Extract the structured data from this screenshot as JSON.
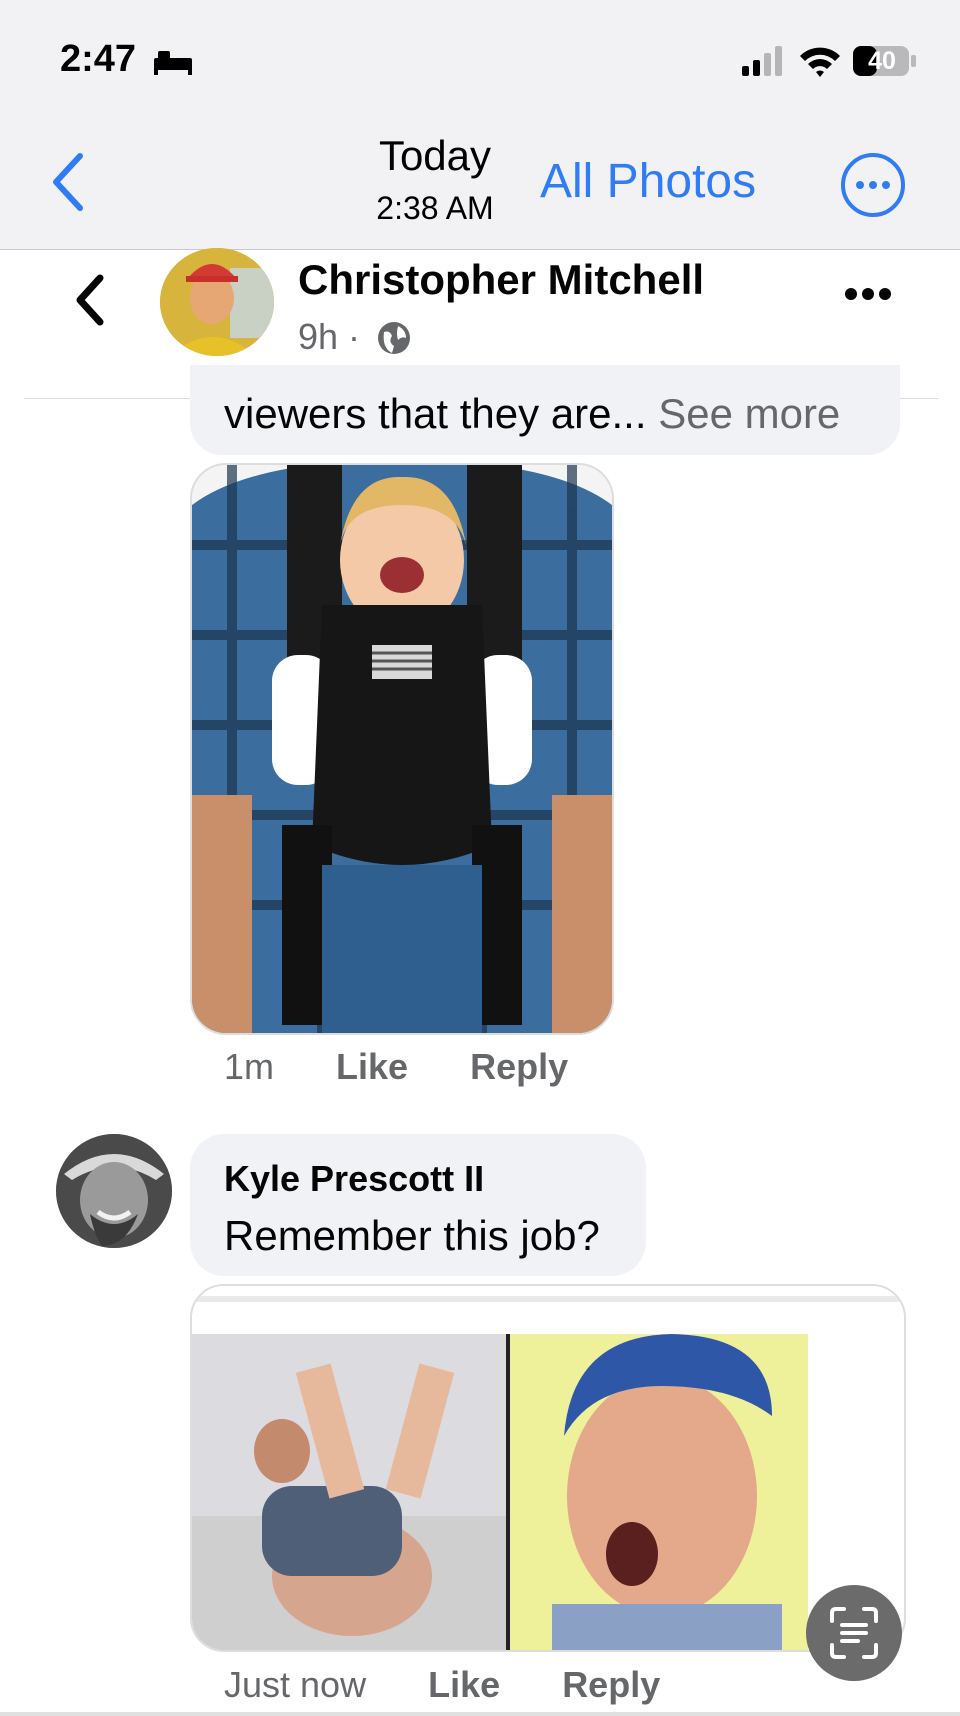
{
  "status_bar": {
    "time": "2:47",
    "battery": "40"
  },
  "photos_header": {
    "date": "Today",
    "time": "2:38 AM",
    "all_photos": "All Photos"
  },
  "post": {
    "author": "Christopher Mitchell",
    "age": "9h ·"
  },
  "comment1": {
    "text": "viewers that they are...",
    "see_more": "See more",
    "time": "1m",
    "like": "Like",
    "reply": "Reply"
  },
  "comment2": {
    "author": "Kyle Prescott II",
    "text": "Remember this job?",
    "time": "Just now",
    "like": "Like",
    "reply": "Reply"
  },
  "colors": {
    "ios_blue": "#2f7cf6",
    "secondary_text": "#65676b",
    "bubble_bg": "#f0f2f5"
  }
}
